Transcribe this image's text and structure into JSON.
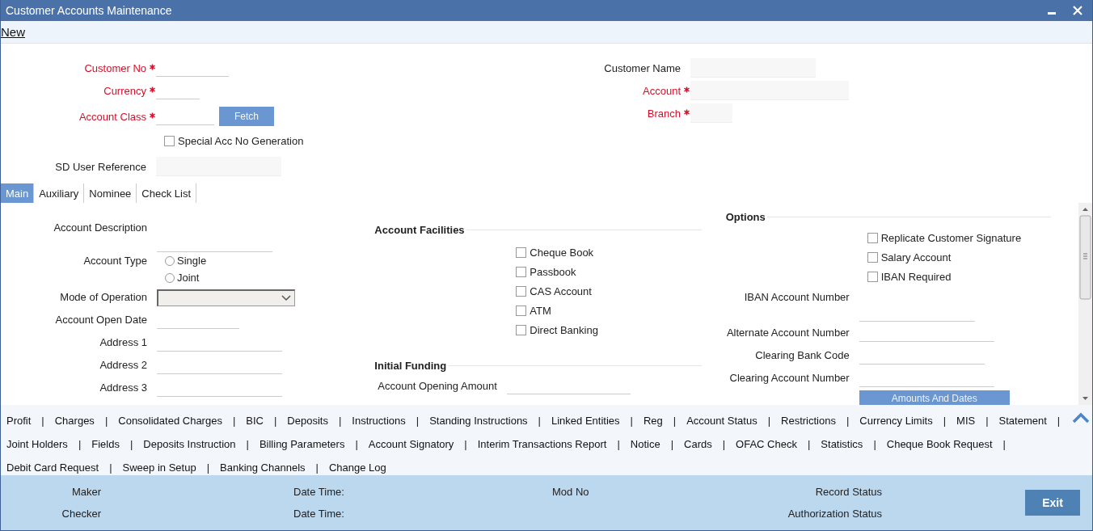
{
  "window": {
    "title": "Customer Accounts Maintenance"
  },
  "toolbar": {
    "new_link": "New"
  },
  "header": {
    "left": [
      {
        "kind": "field",
        "label": "Customer No",
        "required": true
      },
      {
        "kind": "field",
        "label": "Currency",
        "required": true
      },
      {
        "kind": "field_button",
        "label": "Account Class",
        "required": true,
        "button": "Fetch"
      },
      {
        "kind": "checkbox",
        "label": "Special Acc No Generation",
        "checked": false
      },
      {
        "kind": "readonly",
        "label": "SD User Reference",
        "required": false
      }
    ],
    "right": [
      {
        "kind": "readonly",
        "label": "Customer Name",
        "required": false
      },
      {
        "kind": "readonly",
        "label": "Account",
        "required": true
      },
      {
        "kind": "readonly",
        "label": "Branch",
        "required": true
      }
    ]
  },
  "tabs": [
    {
      "label": "Main",
      "selected": true
    },
    {
      "label": "Auxiliary",
      "selected": false
    },
    {
      "label": "Nominee",
      "selected": false
    },
    {
      "label": "Check List",
      "selected": false
    }
  ],
  "main": {
    "left": [
      {
        "kind": "field_below",
        "label": "Account Description"
      },
      {
        "kind": "radio",
        "label": "Account Type",
        "options": [
          {
            "label": "Single",
            "selected": false
          },
          {
            "label": "Joint",
            "selected": false
          }
        ]
      },
      {
        "kind": "select",
        "label": "Mode of Operation"
      },
      {
        "kind": "field",
        "label": "Account Open Date"
      },
      {
        "kind": "field",
        "label": "Address 1"
      },
      {
        "kind": "field",
        "label": "Address 2"
      },
      {
        "kind": "field",
        "label": "Address 3"
      }
    ],
    "facilities": {
      "title": "Account Facilities",
      "items": [
        {
          "label": "Cheque Book",
          "checked": false
        },
        {
          "label": "Passbook",
          "checked": false
        },
        {
          "label": "CAS Account",
          "checked": false
        },
        {
          "label": "ATM",
          "checked": false
        },
        {
          "label": "Direct Banking",
          "checked": false
        }
      ]
    },
    "initial_funding": {
      "title": "Initial Funding",
      "fields": [
        {
          "label": "Account Opening Amount"
        }
      ]
    },
    "options": {
      "title": "Options",
      "checkboxes": [
        {
          "label": "Replicate Customer Signature",
          "checked": false
        },
        {
          "label": "Salary Account",
          "checked": false
        },
        {
          "label": "IBAN Required",
          "checked": false
        }
      ],
      "fields": [
        {
          "kind": "field_below",
          "label": "IBAN Account Number"
        },
        {
          "kind": "field",
          "label": "Alternate Account Number"
        },
        {
          "kind": "field",
          "label": "Clearing Bank Code"
        },
        {
          "kind": "field",
          "label": "Clearing Account Number"
        }
      ],
      "button": "Amounts And Dates"
    }
  },
  "bottom_links": {
    "separator": "|",
    "rows": [
      {
        "items": [
          "Profit",
          "Charges",
          "Consolidated Charges",
          "BIC",
          "Deposits",
          "Instructions",
          "Standing Instructions",
          "Linked Entities",
          "Reg",
          "Account Status",
          "Restrictions",
          "Currency Limits",
          "MIS",
          "Statement"
        ],
        "trailing_separator": true
      },
      {
        "items": [
          "Joint Holders",
          "Fields",
          "Deposits Instruction",
          "Billing Parameters",
          "Account Signatory",
          "Interim Transactions Report",
          "Notice",
          "Cards",
          "OFAC Check",
          "Statistics",
          "Cheque Book Request"
        ],
        "trailing_separator": true
      },
      {
        "items": [
          "Debit Card Request",
          "Sweep in Setup",
          "Banking Channels",
          "Change Log"
        ],
        "trailing_separator": false
      }
    ]
  },
  "footer": {
    "rows": [
      [
        "Maker",
        "Date Time:",
        "Mod No",
        "Record Status"
      ],
      [
        "Checker",
        "Date Time:",
        "",
        "Authorization Status"
      ]
    ],
    "exit_button": "Exit"
  }
}
